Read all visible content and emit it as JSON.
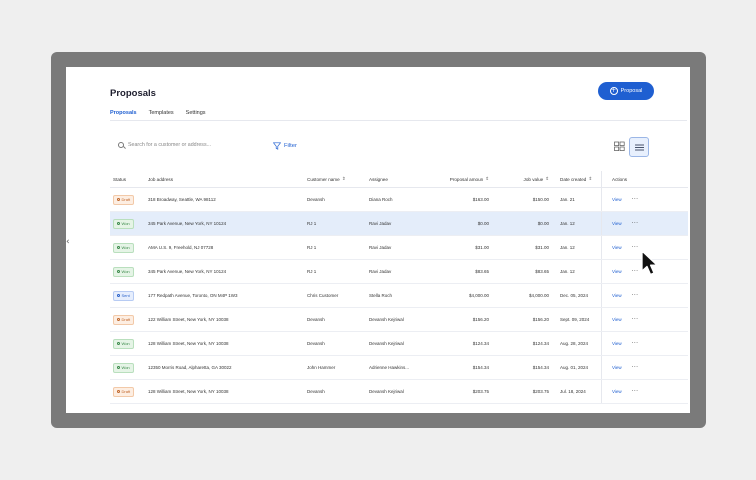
{
  "page": {
    "title": "Proposals",
    "new_button": "Proposal"
  },
  "tabs": [
    {
      "label": "Proposals",
      "active": true
    },
    {
      "label": "Templates",
      "active": false
    },
    {
      "label": "Settings",
      "active": false
    }
  ],
  "toolbar": {
    "search_placeholder": "Search for a customer or address...",
    "filter_label": "Filter",
    "view_mode": "list"
  },
  "table": {
    "headers": {
      "status": "Status",
      "address": "Job address",
      "customer": "Customer name",
      "assignee": "Assignee",
      "proposal_amount": "Proposal amoun",
      "job_value": "Job value",
      "date_created": "Date created",
      "actions": "Actions"
    },
    "rows": [
      {
        "status": "Draft",
        "address": "318 Broadway, Seattle, WA 98112",
        "customer": "Devansh",
        "assignee": "Diana Roch",
        "proposal_amount": "$163.00",
        "job_value": "$150.00",
        "date": "Jan. 21",
        "action": "View"
      },
      {
        "status": "Won",
        "address": "345 Park Avenue, New York, NY 10124",
        "customer": "RJ 1",
        "assignee": "Ravi Jadav",
        "proposal_amount": "$0.00",
        "job_value": "$0.00",
        "date": "Jan. 12",
        "action": "View"
      },
      {
        "status": "Won",
        "address": "AMA U.S. 9, Freehold, NJ 07728",
        "customer": "RJ 1",
        "assignee": "Ravi Jadav",
        "proposal_amount": "$31.00",
        "job_value": "$31.00",
        "date": "Jan. 12",
        "action": "View"
      },
      {
        "status": "Won",
        "address": "345 Park Avenue, New York, NY 10124",
        "customer": "RJ 1",
        "assignee": "Ravi Jadav",
        "proposal_amount": "$83.65",
        "job_value": "$83.65",
        "date": "Jan. 12",
        "action": "View"
      },
      {
        "status": "Sent",
        "address": "177 Redpath Avenue, Toronto, ON M4P 1W3",
        "customer": "Chris Customer",
        "assignee": "Stella Roch",
        "proposal_amount": "$4,000.00",
        "job_value": "$4,000.00",
        "date": "Dec. 05, 2024",
        "action": "View"
      },
      {
        "status": "Draft",
        "address": "122 William Street, New York, NY 10038",
        "customer": "Devansh",
        "assignee": "Devansh Kejriwal",
        "proposal_amount": "$156.20",
        "job_value": "$156.20",
        "date": "Sept. 09, 2024",
        "action": "View"
      },
      {
        "status": "Won",
        "address": "128 William Street, New York, NY 10038",
        "customer": "Devansh",
        "assignee": "Devansh Kejriwal",
        "proposal_amount": "$124.34",
        "job_value": "$124.34",
        "date": "Aug. 28, 2024",
        "action": "View"
      },
      {
        "status": "Won",
        "address": "12350 Morris Road, Alpharetta, GA 30022",
        "customer": "John Hammer",
        "assignee": "Adrienne Hawkins...",
        "proposal_amount": "$154.34",
        "job_value": "$154.34",
        "date": "Aug. 01, 2024",
        "action": "View"
      },
      {
        "status": "Draft",
        "address": "128 William Street, New York, NY 10038",
        "customer": "Devansh",
        "assignee": "Devansh Kejriwal",
        "proposal_amount": "$203.75",
        "job_value": "$203.75",
        "date": "Jul. 18, 2024",
        "action": "View"
      }
    ]
  },
  "colors": {
    "accent": "#1f5fd1",
    "draft": "#c0662a",
    "won": "#3b8a4a",
    "sent": "#2a62c9",
    "selected_row": "#e4edfa"
  },
  "icons": [
    "plus-circle-icon",
    "search-icon",
    "filter-icon",
    "grid-view-icon",
    "list-view-icon",
    "chevron-left-icon",
    "sort-icon",
    "more-icon",
    "mouse-cursor-icon"
  ]
}
